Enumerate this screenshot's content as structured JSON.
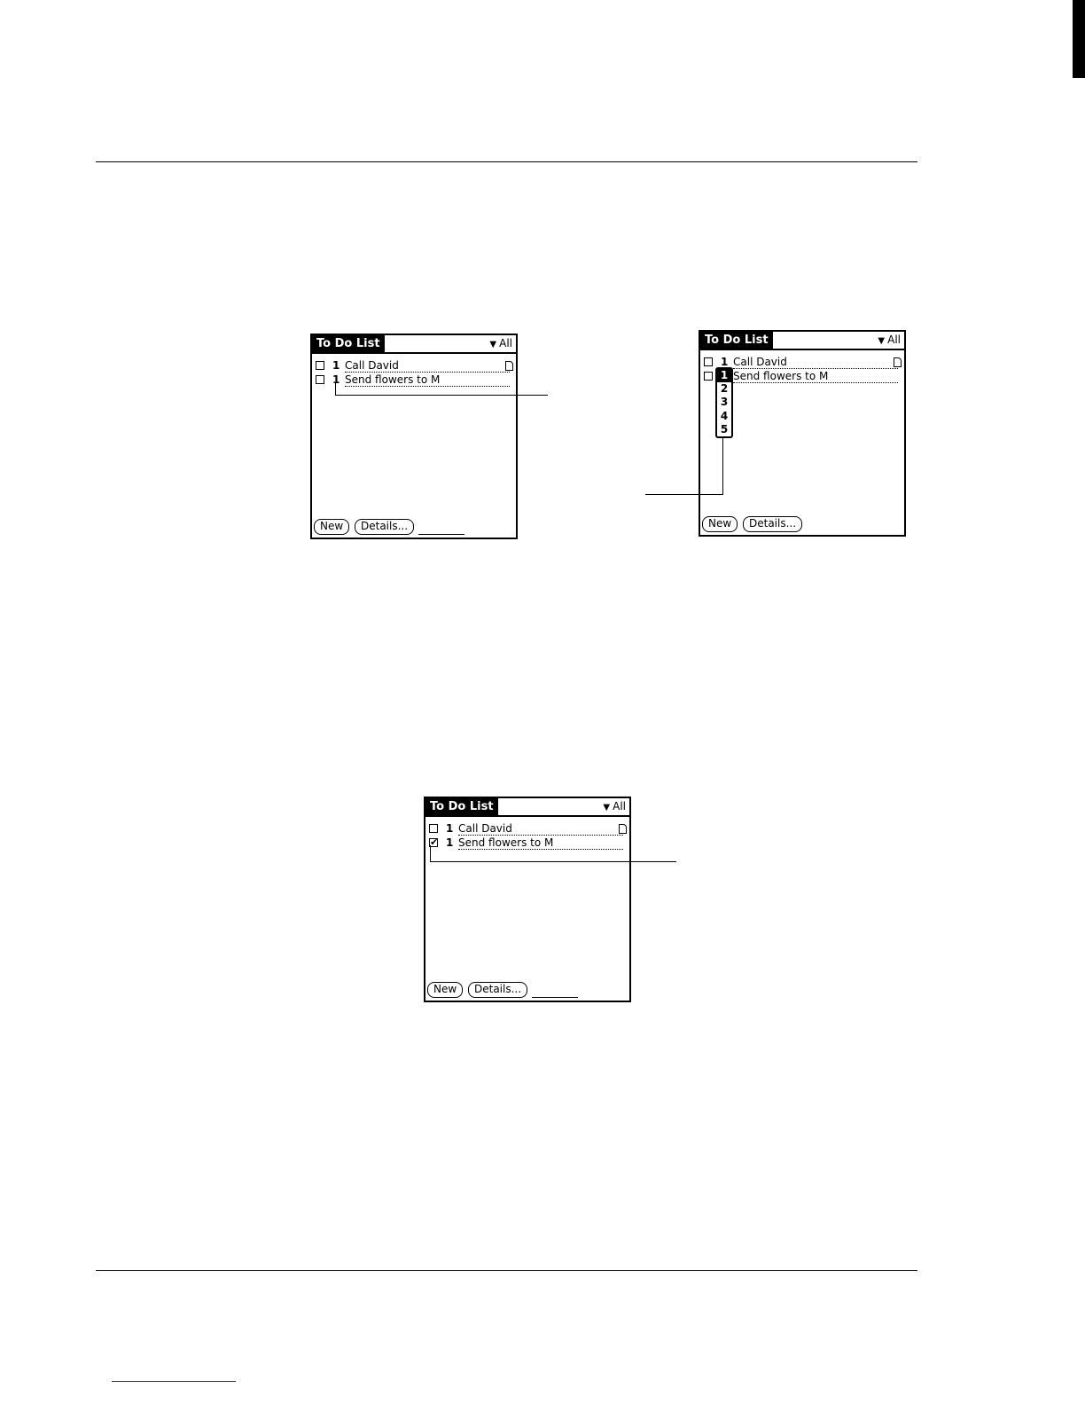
{
  "todo_app": {
    "title": "To Do List",
    "category": "All",
    "new_label": "New",
    "details_label": "Details..."
  },
  "screen_a": {
    "items": [
      {
        "priority": "1",
        "description": "Call David",
        "completed": false,
        "has_note": true
      },
      {
        "priority": "1",
        "description": "Send flowers to M",
        "completed": false,
        "has_note": false
      }
    ]
  },
  "screen_b": {
    "items": [
      {
        "priority": "1",
        "description": "Call David",
        "completed": false,
        "has_note": true
      },
      {
        "priority": "1",
        "description": "Send flowers to M",
        "completed": false,
        "has_note": false
      }
    ],
    "priority_options": [
      "1",
      "2",
      "3",
      "4",
      "5"
    ],
    "selected_priority": "1"
  },
  "screen_c": {
    "items": [
      {
        "priority": "1",
        "description": "Call David",
        "completed": false,
        "has_note": true
      },
      {
        "priority": "1",
        "description": "Send flowers to M",
        "completed": true,
        "has_note": false
      }
    ]
  },
  "icons": {
    "checkmark": "✔",
    "dropdown_arrow": "▼"
  }
}
